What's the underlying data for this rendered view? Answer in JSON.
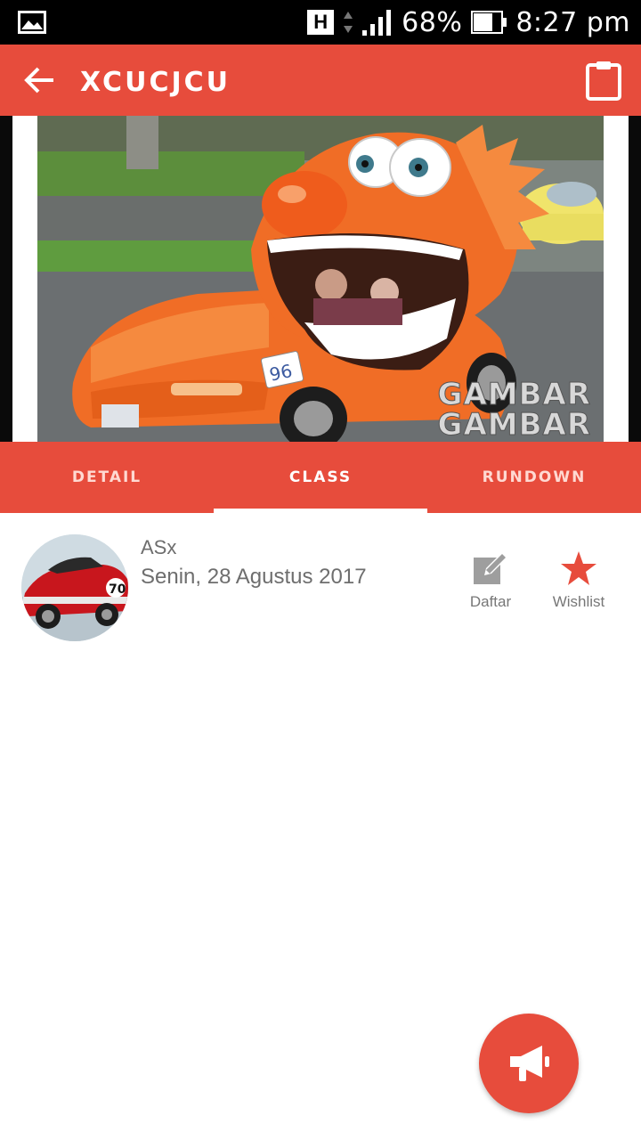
{
  "status_bar": {
    "network_badge": "H",
    "battery": "68%",
    "time": "8:27 pm"
  },
  "app_bar": {
    "title": "XCUCJCU"
  },
  "banner": {
    "watermark_line1": "GAMBAR",
    "watermark_line2": "GAMBAR",
    "plate_number": "96"
  },
  "tabs": [
    {
      "label": "DETAIL",
      "active": false
    },
    {
      "label": "CLASS",
      "active": true
    },
    {
      "label": "RUNDOWN",
      "active": false
    }
  ],
  "event": {
    "name": "ASx",
    "date": "Senin, 28 Agustus 2017",
    "avatar_number": "70",
    "actions": {
      "daftar_label": "Daftar",
      "wishlist_label": "Wishlist"
    }
  },
  "colors": {
    "primary": "#e74c3c",
    "text_gray": "#6e6e6e"
  }
}
